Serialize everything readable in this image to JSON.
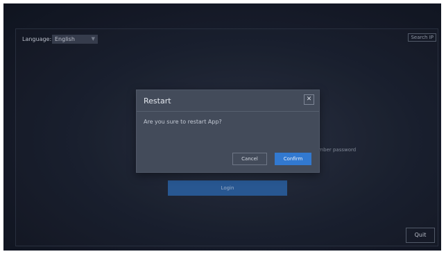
{
  "language": {
    "label": "Language:",
    "value": "English",
    "caret": "▼"
  },
  "search_ip_label": "Search IP",
  "remember_label": "ember password",
  "login_label": "Login",
  "quit_label": "Quit",
  "dialog": {
    "title": "Restart",
    "close_glyph": "✕",
    "message": "Are you sure to restart App?",
    "cancel_label": "Cancel",
    "confirm_label": "Confirm"
  },
  "colors": {
    "accent": "#3279d0",
    "login": "#2c5f9e",
    "background": "#1a2030"
  }
}
